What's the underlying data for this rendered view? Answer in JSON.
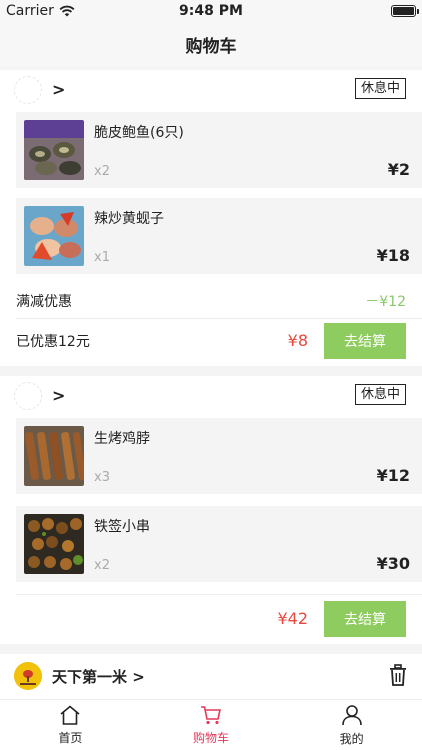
{
  "status_bar": {
    "carrier": "Carrier",
    "time": "9:48 PM",
    "battery_level": 1.0
  },
  "nav": {
    "title": "购物车"
  },
  "carts": [
    {
      "badge": "休息中",
      "items": [
        {
          "name": "脆皮鲍鱼(6只)",
          "qty": "x2",
          "price": "¥2"
        },
        {
          "name": "辣炒黄蚬子",
          "qty": "x1",
          "price": "¥18"
        }
      ],
      "discount_label": "满减优惠",
      "discount_amount": "－¥12",
      "saved_label": "已优惠12元",
      "total": "¥8",
      "checkout_label": "去结算"
    },
    {
      "badge": "休息中",
      "items": [
        {
          "name": "生烤鸡脖",
          "qty": "x3",
          "price": "¥12"
        },
        {
          "name": "铁签小串",
          "qty": "x2",
          "price": "¥30"
        }
      ],
      "total": "¥42",
      "checkout_label": "去结算"
    }
  ],
  "shop3": {
    "name": "天下第一米",
    "chevron": ">"
  },
  "tabbar": [
    {
      "label": "首页",
      "icon": "home-icon",
      "active": false
    },
    {
      "label": "购物车",
      "icon": "cart-icon",
      "active": true
    },
    {
      "label": "我的",
      "icon": "user-icon",
      "active": false
    }
  ],
  "colors": {
    "accent": "#e33a5b",
    "price_red": "#e9483d",
    "discount_green": "#8bc76b",
    "checkout_green": "#8fcc5f"
  }
}
